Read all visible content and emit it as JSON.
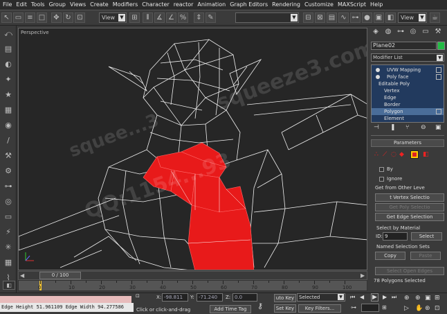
{
  "menu": [
    "File",
    "Edit",
    "Tools",
    "Group",
    "Views",
    "Create",
    "Modifiers",
    "Character",
    "reactor",
    "Animation",
    "Graph Editors",
    "Rendering",
    "Customize",
    "MAXScript",
    "Help"
  ],
  "toolbar": {
    "view_dropdown": "View",
    "view_dropdown2": "View"
  },
  "viewport": {
    "label": "Perspective",
    "watermark1": "squeeze3.com",
    "watermark2": "QQ:1154...93",
    "watermark3": "squee...3"
  },
  "command_panel": {
    "object_name": "Plane02",
    "object_color": "#22bb44",
    "modifier_list": "Modifier List",
    "stack": [
      {
        "label": "UVW Mapping",
        "indent": 1,
        "bulb": true
      },
      {
        "label": "Poly face",
        "indent": 1,
        "bulb": true
      },
      {
        "label": "Editable Poly",
        "indent": 0,
        "bulb": false
      },
      {
        "label": "Vertex",
        "indent": 2,
        "bulb": false
      },
      {
        "label": "Edge",
        "indent": 2,
        "bulb": false
      },
      {
        "label": "Border",
        "indent": 2,
        "bulb": false
      },
      {
        "label": "Polygon",
        "indent": 2,
        "bulb": false,
        "selected": true
      },
      {
        "label": "Element",
        "indent": 2,
        "bulb": false
      }
    ],
    "parameters_title": "Parameters",
    "by_label": "By",
    "ignore_label": "Ignore",
    "get_from_other": "Get from Other Leve",
    "get_vertex_sel": "t Vertex Selectio",
    "get_poly_sel": "Get Poly Selectio",
    "get_edge_sel": "Get Edge Selection",
    "select_by_material": "Select by Material",
    "id_label": "ID:",
    "id_value": "9",
    "select_btn": "Select",
    "named_sel": "Named Selection Sets",
    "copy_btn": "Copy",
    "paste_btn": "Paste",
    "select_open_edges": "Select Open Edges",
    "polys_selected": "78 Polygons Selected"
  },
  "timeline": {
    "frame_label": "0 / 100",
    "ticks": [
      "0",
      "10",
      "20",
      "30",
      "40",
      "50",
      "60",
      "70",
      "80",
      "90",
      "100"
    ]
  },
  "status": {
    "edge_text": "Edge Height 51.961109 Edge Width 94.277586",
    "x_label": "X:",
    "x_value": "-98.811",
    "y_label": "Y:",
    "y_value": "-71.240",
    "z_label": "Z:",
    "z_value": "0.0",
    "prompt": "Click or click-and-drag",
    "add_time_tag": "Add Time Tag",
    "auto_key": "uto Key",
    "selected": "Selected",
    "set_key": "Set Key",
    "key_filters": "Key Filters..."
  }
}
